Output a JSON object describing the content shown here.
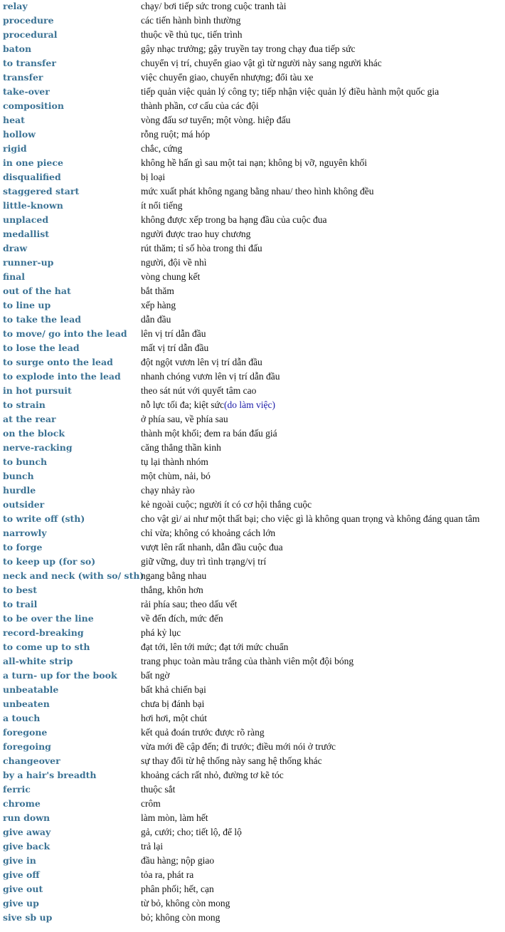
{
  "entries": [
    {
      "term": "relay",
      "definition": "chạy/ bơi tiếp sức trong cuộc tranh tài"
    },
    {
      "term": "procedure",
      "definition": "các tiến hành bình thường"
    },
    {
      "term": "procedural",
      "definition": "thuộc về thủ tục, tiến trình"
    },
    {
      "term": "baton",
      "definition": "gậy nhạc trưởng; gậy truyền tay trong chạy đua tiếp sức"
    },
    {
      "term": "to transfer",
      "definition": "chuyển vị trí, chuyển giao vật gì từ người này sang người khác"
    },
    {
      "term": "transfer",
      "definition": "việc chuyển giao, chuyển nhượng; đổi tàu xe"
    },
    {
      "term": "take-over",
      "definition": "tiếp quản việc quản lý công ty; tiếp nhận việc quản lý điều hành một quốc gia"
    },
    {
      "term": "composition",
      "definition": "thành phần, cơ cấu của các đội"
    },
    {
      "term": "heat",
      "definition": "vòng đấu sơ tuyển; một vòng. hiệp đấu"
    },
    {
      "term": "hollow",
      "definition": "rỗng ruột; má hóp"
    },
    {
      "term": "rigid",
      "definition": "chắc, cứng"
    },
    {
      "term": "in one piece",
      "definition": "không hề hấn gì sau một tai nạn; không bị vỡ, nguyên khối"
    },
    {
      "term": "disqualified",
      "definition": "bị loại"
    },
    {
      "term": "staggered start",
      "definition": "mức xuất phát không ngang bằng nhau/ theo hình không đều"
    },
    {
      "term": "little-known",
      "definition": "ít nổi tiếng"
    },
    {
      "term": "unplaced",
      "definition": "không được xếp trong ba hạng đầu của cuộc đua"
    },
    {
      "term": "medallist",
      "definition": "người được trao huy chương"
    },
    {
      "term": "draw",
      "definition": "rút thăm; tỉ số hòa trong thi đấu"
    },
    {
      "term": "runner-up",
      "definition": "người, đội về nhì"
    },
    {
      "term": "final",
      "definition": "vòng chung kết"
    },
    {
      "term": "out of the hat",
      "definition": "bắt thăm"
    },
    {
      "term": "to line up",
      "definition": "xếp hàng"
    },
    {
      "term": "to take the lead",
      "definition": "dẫn đầu"
    },
    {
      "term": "to move/ go into the lead",
      "definition": "lên vị trí dẫn đầu"
    },
    {
      "term": "to lose the lead",
      "definition": "mất vị trí dẫn đầu"
    },
    {
      "term": "to surge onto the lead",
      "definition": "đột ngột vươn lên vị trí dẫn đầu"
    },
    {
      "term": "to explode into the lead",
      "definition": "nhanh chóng vươn lên vị trí dẫn đầu"
    },
    {
      "term": "in hot pursuit",
      "definition": "theo sát nút với quyết tâm cao"
    },
    {
      "term": "to strain",
      "definition": "nỗ lực tối đa; kiệt sức",
      "note": "(do làm việc)"
    },
    {
      "term": "at the rear",
      "definition": "ở phía sau, về phía sau"
    },
    {
      "term": "on the block",
      "definition": "thành một khối; đem ra bán đấu giá"
    },
    {
      "term": "nerve-racking",
      "definition": "căng thẳng thần kinh"
    },
    {
      "term": "to bunch",
      "definition": "tụ lại thành nhóm"
    },
    {
      "term": "bunch",
      "definition": "một chùm, nải, bó"
    },
    {
      "term": "hurdle",
      "definition": "chạy nhảy rào"
    },
    {
      "term": "outsider",
      "definition": "kẻ ngoài cuộc; người ít có cơ hội thắng cuộc"
    },
    {
      "term": "to write off (sth)",
      "definition": "cho vật gì/ ai như một thất bại; cho việc gì là không quan trọng và không đáng quan tâm"
    },
    {
      "term": "narrowly",
      "definition": "chỉ vừa; không có khoảng cách lớn"
    },
    {
      "term": "to forge",
      "definition": "vượt lên rất nhanh, dẫn đầu cuộc đua"
    },
    {
      "term": "to keep up (for so)",
      "definition": "giữ vững, duy trì tình trạng/vị trí"
    },
    {
      "term": "neck and neck (with so/ sth)",
      "definition": "ngang bằng nhau"
    },
    {
      "term": "to best",
      "definition": "thắng, khôn hơn"
    },
    {
      "term": "to trail",
      "definition": "rải phía sau; theo dấu vết"
    },
    {
      "term": "to be over the line",
      "definition": "về đến đích, mức đến"
    },
    {
      "term": "record-breaking",
      "definition": "phá kỷ lục"
    },
    {
      "term": "to come up to sth",
      "definition": "đạt tới, lên tới mức; đạt tới mức chuẩn"
    },
    {
      "term": "all-white strip",
      "definition": "trang phục toàn màu trắng của thành viên một đội bóng"
    },
    {
      "term": "a turn- up for the book",
      "definition": "bất ngờ"
    },
    {
      "term": "unbeatable",
      "definition": "bất khả chiến bại"
    },
    {
      "term": "unbeaten",
      "definition": "chưa bị đánh bại"
    },
    {
      "term": "a touch",
      "definition": "hơi hơi, một chút"
    },
    {
      "term": "foregone",
      "definition": "kết quả đoán trước được rõ ràng"
    },
    {
      "term": "foregoing",
      "definition": "vừa mới đề cập đến; đi trước; điều mới nói ở trước"
    },
    {
      "term": "changeover",
      "definition": "sự thay đổi từ hệ thống này sang hệ thống khác"
    },
    {
      "term": "by a hair's breadth",
      "definition": "khoảng cách rất nhỏ, đường tơ kẽ tóc"
    },
    {
      "term": "ferric",
      "definition": "thuộc sắt"
    },
    {
      "term": "chrome",
      "definition": "crôm"
    },
    {
      "term": "run down",
      "definition": "làm mòn, làm hết"
    },
    {
      "term": "give away",
      "definition": "gả, cưới; cho; tiết lộ, để lộ"
    },
    {
      "term": "give back",
      "definition": "trả lại"
    },
    {
      "term": "give in",
      "definition": "đầu hàng; nộp giao"
    },
    {
      "term": "give off",
      "definition": "tỏa ra, phát ra"
    },
    {
      "term": "give out",
      "definition": "phân phối; hết, cạn"
    },
    {
      "term": "give up",
      "definition": "từ bỏ, không còn mong"
    },
    {
      "term": "sive sb up",
      "definition": "bỏ; không còn mong"
    }
  ],
  "colors": {
    "term": "#3b7294",
    "definition": "#111111",
    "note": "#1a1aa8",
    "background": "#ffffff"
  }
}
